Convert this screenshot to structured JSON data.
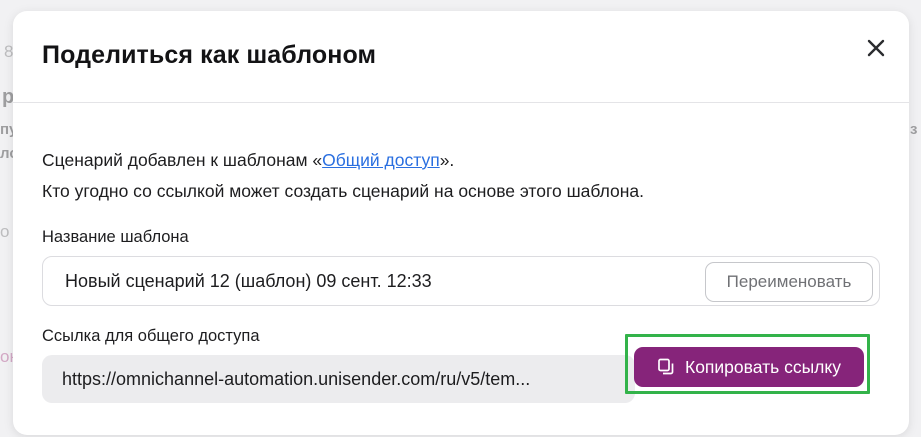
{
  "background": {
    "frag_1": "8",
    "frag_2": "р",
    "frag_3": "пу",
    "frag_4": "лс",
    "frag_5": "о",
    "frag_6": "он",
    "frag_7": "з"
  },
  "modal": {
    "title": "Поделиться как шаблоном",
    "close_icon": "close-icon",
    "info_prefix": "Сценарий добавлен к шаблонам «",
    "info_link": "Общий доступ",
    "info_suffix": "».",
    "info_line2": "Кто угодно со ссылкой может создать сценарий на основе этого шаблона.",
    "name_label": "Название шаблона",
    "name_value": "Новый сценарий 12 (шаблон) 09 сент. 12:33",
    "rename_label": "Переименовать",
    "link_label": "Ссылка для общего доступа",
    "link_value": "https://omnichannel-automation.unisender.com/ru/v5/tem...",
    "copy_label": "Копировать ссылку",
    "copy_icon": "copy-icon"
  },
  "colors": {
    "accent": "#86247a",
    "link": "#2a6fe0",
    "highlight": "#33b34a"
  }
}
